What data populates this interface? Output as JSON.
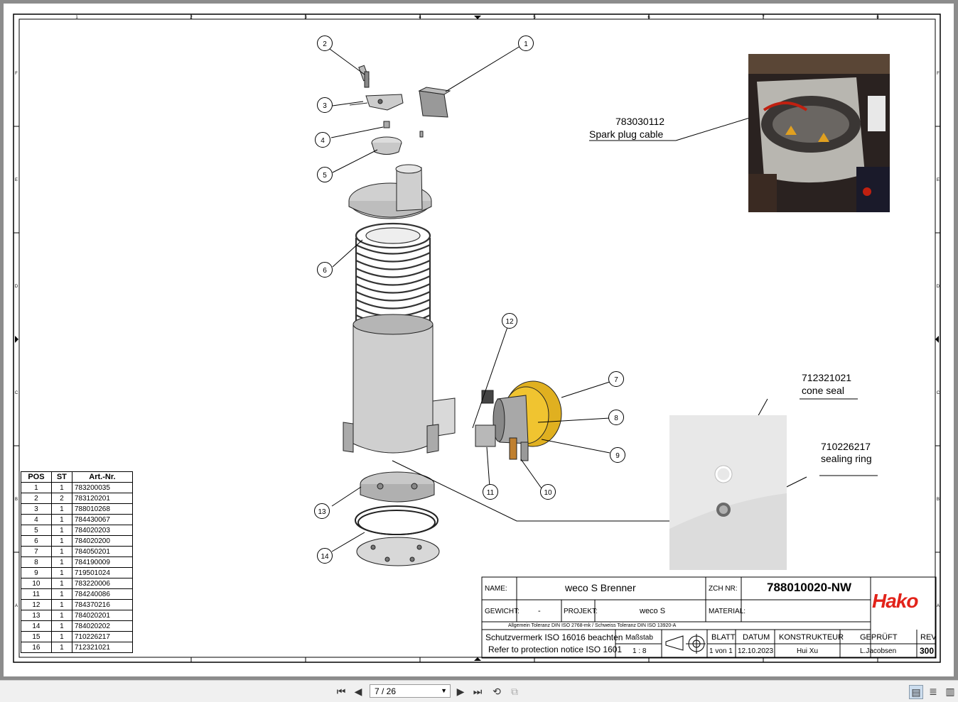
{
  "drawing": {
    "callouts": [
      "1",
      "2",
      "3",
      "4",
      "5",
      "6",
      "7",
      "8",
      "9",
      "10",
      "11",
      "12",
      "13",
      "14"
    ],
    "photo1_note": {
      "number": "783030112",
      "label": "Spark plug cable"
    },
    "photo2_note1": {
      "number": "712321021",
      "label": "cone seal"
    },
    "photo2_note2": {
      "number": "710226217",
      "label": "sealing ring"
    },
    "border_numbers": [
      "1",
      "2",
      "3",
      "4",
      "5",
      "6",
      "7",
      "8"
    ],
    "border_letters": [
      "F",
      "E",
      "D",
      "C",
      "B",
      "A"
    ]
  },
  "bom": {
    "headers": [
      "POS",
      "ST",
      "Art.-Nr."
    ],
    "rows": [
      [
        "1",
        "1",
        "783200035"
      ],
      [
        "2",
        "2",
        "783120201"
      ],
      [
        "3",
        "1",
        "788010268"
      ],
      [
        "4",
        "1",
        "784430067"
      ],
      [
        "5",
        "1",
        "784020203"
      ],
      [
        "6",
        "1",
        "784020200"
      ],
      [
        "7",
        "1",
        "784050201"
      ],
      [
        "8",
        "1",
        "784190009"
      ],
      [
        "9",
        "1",
        "719501024"
      ],
      [
        "10",
        "1",
        "783220006"
      ],
      [
        "11",
        "1",
        "784240086"
      ],
      [
        "12",
        "1",
        "784370216"
      ],
      [
        "13",
        "1",
        "784020201"
      ],
      [
        "14",
        "1",
        "784020202"
      ],
      [
        "15",
        "1",
        "710226217"
      ],
      [
        "16",
        "1",
        "712321021"
      ]
    ]
  },
  "title_block": {
    "name_label": "NAME:",
    "name_value": "weco S Brenner",
    "zch_label": "ZCH NR:",
    "zch_value": "788010020-NW",
    "gewicht_label": "GEWICHT:",
    "gewicht_value": "-",
    "projekt_label": "PROJEKT:",
    "projekt_value": "weco S",
    "material_label": "MATERIAL:",
    "material_value": "",
    "tolerance": "Allgemein Toleranz DIN ISO 2768-mk / Schweiss Toleranz DIN ISO 13920-A",
    "protection1": "Schutzvermerk  ISO 16016 beachten",
    "protection2": "Refer to protection notice ISO 1601",
    "massstab_label": "Maßstab",
    "massstab_value": "1 : 8",
    "blatt_label": "BLATT",
    "blatt_value": "1 von 1",
    "datum_label": "DATUM",
    "datum_value": "12.10.2023",
    "konstrukteur_label": "KONSTRUKTEUR",
    "konstrukteur_value": "Hui Xu",
    "geprueft_label": "GEPRÜFT",
    "geprueft_value": "L.Jacobsen",
    "rev_label": "REV",
    "rev_value": "300",
    "logo": "Hako",
    "logo_color": "#e2231a"
  },
  "toolbar": {
    "page_indicator": "7 / 26",
    "icons": [
      "first-page-icon",
      "prev-page-icon",
      "next-page-icon",
      "last-page-icon",
      "rotate-icon",
      "copy-icon",
      "single-page-icon",
      "continuous-icon",
      "two-page-icon"
    ]
  }
}
